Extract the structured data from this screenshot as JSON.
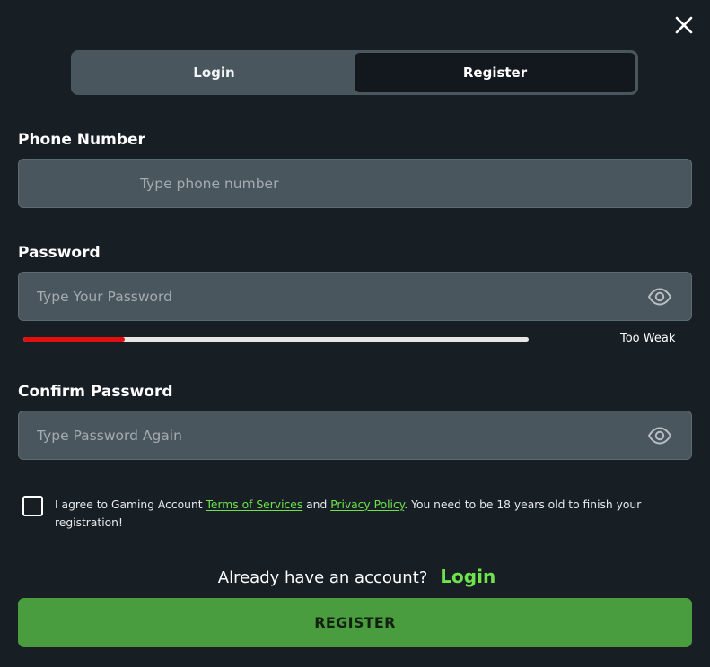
{
  "tabs": [
    {
      "label": "Login",
      "active": false
    },
    {
      "label": "Register",
      "active": true
    }
  ],
  "phone": {
    "label": "Phone Number",
    "placeholder": "Type phone number"
  },
  "password": {
    "label": "Password",
    "placeholder": "Type Your Password",
    "strength_label": "Too Weak",
    "strength_fraction": 0.2
  },
  "confirm": {
    "label": "Confirm Password",
    "placeholder": "Type Password Again"
  },
  "agreement": {
    "prefix": "I agree to Gaming Account ",
    "terms": "Terms of Services",
    "and": " and ",
    "privacy": "Privacy Policy",
    "suffix": ". You need to be 18 years old to finish your registration!"
  },
  "already": {
    "text": "Already have an account?",
    "link": "Login"
  },
  "register_button": "REGISTER",
  "icons": {
    "close": "close-icon",
    "eye": "eye-icon"
  },
  "colors": {
    "background": "#171e24",
    "field": "#4a565e",
    "accent_green": "#6fe34d",
    "button_green": "#4a9d3f",
    "strength_red": "#e30f0f"
  }
}
